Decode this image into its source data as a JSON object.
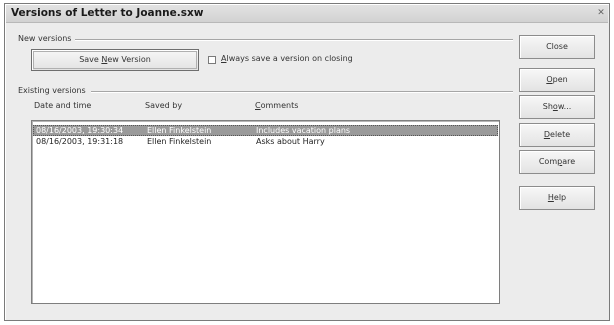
{
  "window": {
    "title": "Versions of Letter to Joanne.sxw",
    "close_glyph": "✕"
  },
  "new_versions": {
    "group_label": "New versions",
    "save_button": {
      "pre": "Save ",
      "accel": "N",
      "post": "ew Version"
    },
    "always_save": {
      "accel": "A",
      "rest": "lways save a version on closing",
      "checked": false
    }
  },
  "existing_versions": {
    "group_label": "Existing versions",
    "columns": {
      "date": "Date and time",
      "saved_by": "Saved by",
      "comments_accel": "C",
      "comments_rest": "omments"
    },
    "rows": [
      {
        "date": "08/16/2003, 19:30:34",
        "saved_by": "Ellen Finkelstein",
        "comment": "Includes vacation plans",
        "selected": true
      },
      {
        "date": "08/16/2003, 19:31:18",
        "saved_by": "Ellen Finkelstein",
        "comment": "Asks about Harry",
        "selected": false
      }
    ]
  },
  "buttons": {
    "close": {
      "label": "Close"
    },
    "open": {
      "accel": "O",
      "rest": "pen"
    },
    "show": {
      "pre": "Sh",
      "accel": "o",
      "post": "w..."
    },
    "delete": {
      "accel": "D",
      "rest": "elete"
    },
    "compare": {
      "pre": "Com",
      "accel": "p",
      "post": "are"
    },
    "help": {
      "accel": "H",
      "rest": "elp"
    }
  }
}
